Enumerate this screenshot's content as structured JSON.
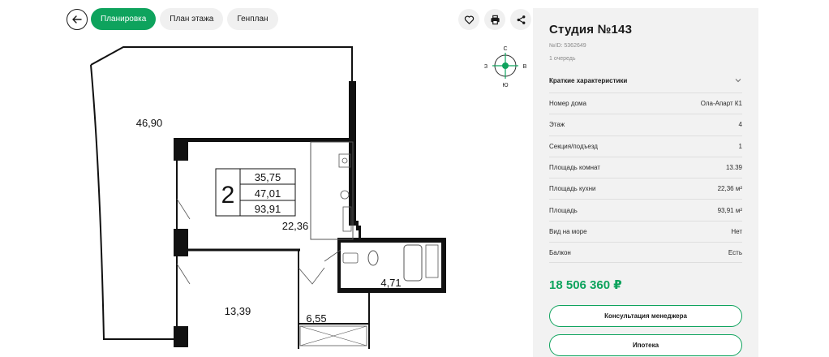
{
  "toolbar": {
    "back_icon": "arrow-left-icon",
    "tabs": [
      {
        "label": "Планировка",
        "active": true
      },
      {
        "label": "План этажа",
        "active": false
      },
      {
        "label": "Генплан",
        "active": false
      }
    ],
    "actions": [
      "heart-icon",
      "printer-icon",
      "share-icon"
    ]
  },
  "plan": {
    "rooms_count": "2",
    "area_box": [
      "35,75",
      "47,01",
      "93,91"
    ],
    "terrace_area": "46,90",
    "kitchen_area": "22,36",
    "bedroom_area": "13,39",
    "hall_area": "6,55",
    "bath_area": "4,71"
  },
  "compass": {
    "north": "С",
    "south": "Ю",
    "west": "З",
    "east": "В"
  },
  "panel": {
    "title": "Студия №143",
    "id_text": "№ID: 5362649",
    "queue": "1 очередь",
    "section_title": "Краткие характеристики",
    "params": [
      {
        "label": "Номер дома",
        "value": "Ола-Апарт К1"
      },
      {
        "label": "Этаж",
        "value": "4"
      },
      {
        "label": "Секция/подъезд",
        "value": "1"
      },
      {
        "label": "Площадь комнат",
        "value": "13.39"
      },
      {
        "label": "Площадь кухни",
        "value": "22,36 м²"
      },
      {
        "label": "Площадь",
        "value": "93,91 м²"
      },
      {
        "label": "Вид на море",
        "value": "Нет"
      },
      {
        "label": "Балкон",
        "value": "Есть"
      }
    ],
    "price": "18 506 360 ₽",
    "consult_button": "Консультация менеджера",
    "mortgage_button": "Ипотека"
  },
  "colors": {
    "accent": "#0ea35d",
    "panel_bg": "#f2f2f2",
    "wall": "#111111"
  }
}
